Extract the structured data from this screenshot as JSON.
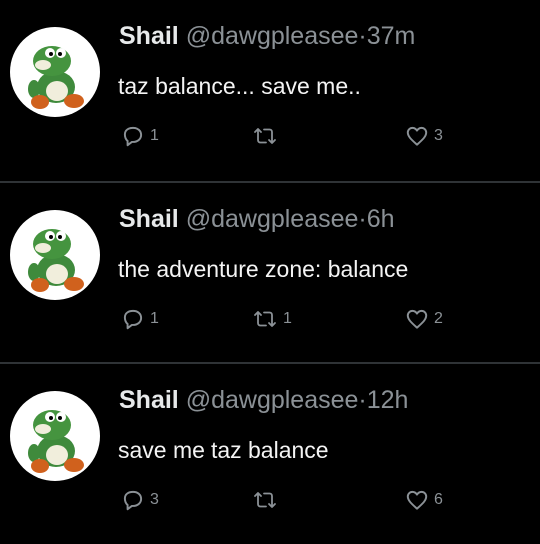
{
  "tweets": [
    {
      "name": "Shail",
      "handle": "@dawgpleasee",
      "separator": "·",
      "time": "37m",
      "text_main": "taz balance",
      "text_tail": "... save me..",
      "replies": "1",
      "retweets": "",
      "likes": "3"
    },
    {
      "name": "Shail",
      "handle": "@dawgpleasee",
      "separator": "·",
      "time": "6h",
      "text_main": "the adventure zone: balance",
      "text_tail": "",
      "replies": "1",
      "retweets": "1",
      "likes": "2"
    },
    {
      "name": "Shail",
      "handle": "@dawgpleasee",
      "separator": "·",
      "time": "12h",
      "text_main": "save me",
      "text_tail": "taz balance",
      "replies": "3",
      "retweets": "",
      "likes": "6"
    }
  ],
  "icons": {
    "avatar": "green-dinosaur-avatar-icon",
    "reply": "reply-bubble-icon",
    "retweet": "retweet-icon",
    "like": "heart-icon"
  },
  "colors": {
    "background": "#000000",
    "text": "#e7e9ea",
    "secondary": "#8b9196",
    "divider": "#2f3336"
  }
}
